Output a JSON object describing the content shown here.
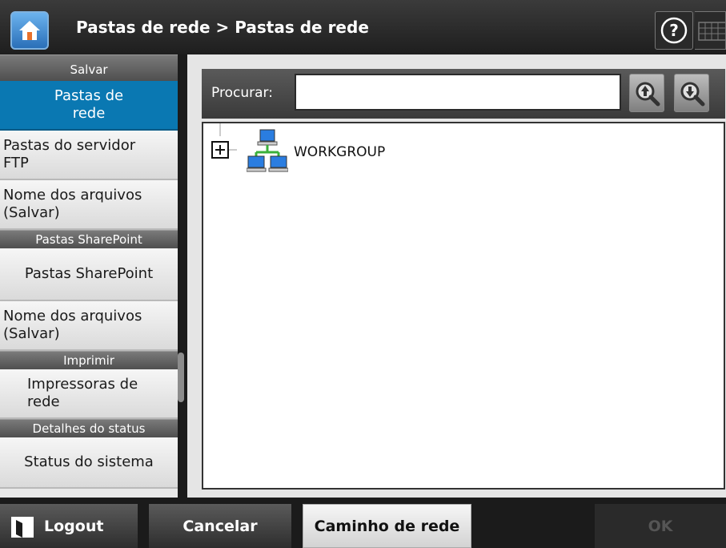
{
  "header": {
    "title": "Pastas de rede > Pastas de rede",
    "home_icon": "home-icon",
    "help_icon": "help-icon",
    "keyboard_icon": "keyboard-icon"
  },
  "sidebar": {
    "sections": [
      {
        "header": "Salvar",
        "items": [
          {
            "label_line1": "Pastas de",
            "label_line2": "rede",
            "active": true
          },
          {
            "label_line1": "Pastas do servidor",
            "label_line2": "FTP"
          },
          {
            "label_line1": "Nome dos arquivos",
            "label_line2": "(Salvar)"
          }
        ]
      },
      {
        "header": "Pastas SharePoint",
        "items": [
          {
            "label_line1": "Pastas SharePoint"
          },
          {
            "label_line1": "Nome dos arquivos",
            "label_line2": "(Salvar)"
          }
        ]
      },
      {
        "header": "Imprimir",
        "items": [
          {
            "label_line1": "Impressoras de",
            "label_line2": "rede"
          }
        ]
      },
      {
        "header": "Detalhes do status",
        "items": [
          {
            "label_line1": "Status do sistema"
          }
        ]
      }
    ]
  },
  "search": {
    "label": "Procurar:",
    "value": "",
    "search_up_icon": "search-up-icon",
    "search_down_icon": "search-down-icon"
  },
  "tree": {
    "nodes": [
      {
        "label": "WORKGROUP",
        "icon": "network-icon",
        "expander": "+"
      }
    ]
  },
  "footer": {
    "logout": "Logout",
    "cancel": "Cancelar",
    "network_path": "Caminho de rede",
    "ok": "OK"
  },
  "colors": {
    "accent": "#0a78b2",
    "header_bg": "#2a2a2a",
    "disabled_text": "#555555"
  }
}
